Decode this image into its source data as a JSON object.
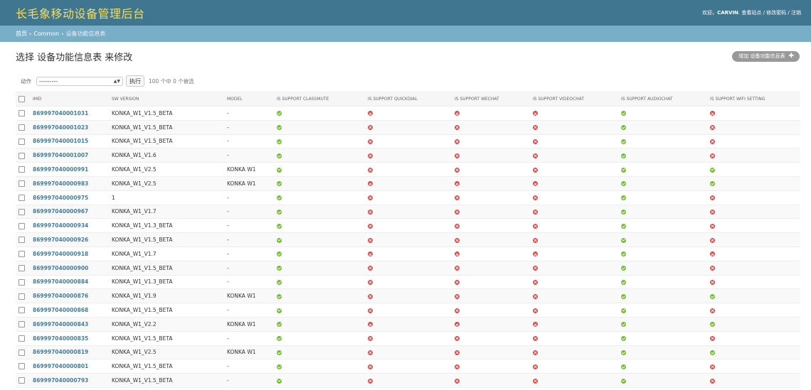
{
  "header": {
    "site_name": "长毛象移动设备管理后台",
    "welcome": "欢迎，",
    "username": "CARVIN",
    "view_site": "查看站点",
    "change_password": "修改密码",
    "logout": "注销",
    "separator": "/"
  },
  "breadcrumbs": {
    "home": "首页",
    "app": "Common",
    "current": "设备功能信息表",
    "separator": "›"
  },
  "page": {
    "title": "选择 设备功能信息表 来修改",
    "add_label": "增加 设备功能信息表",
    "add_icon": "plus-icon"
  },
  "actions": {
    "label": "动作",
    "selected_option": "---------",
    "go_label": "执行",
    "counter": "100 个中 0 个被选"
  },
  "colors": {
    "header_bg": "#417690",
    "brand": "#f5dd5d",
    "breadcrumb_bg": "#79aec8",
    "link": "#447e9b",
    "yes": "#70bf2b",
    "no": "#dd4646"
  },
  "table": {
    "columns": [
      "IMEI",
      "SW VERSION",
      "MODEL",
      "IS SUPPORT CLASSMUTE",
      "IS SUPPORT QUICKDIAL",
      "IS SUPPORT WECHAT",
      "IS SUPPORT VIDEOCHAT",
      "IS SUPPORT AUDIOCHAT",
      "IS SUPPORT WIFI SETTING"
    ],
    "rows": [
      {
        "imei": "869997040001031",
        "sw": "KONKA_W1_V1.5_BETA",
        "model": "-",
        "flags": [
          true,
          false,
          false,
          false,
          true,
          false
        ]
      },
      {
        "imei": "869997040001023",
        "sw": "KONKA_W1_V1.5_BETA",
        "model": "-",
        "flags": [
          true,
          false,
          false,
          false,
          true,
          false
        ]
      },
      {
        "imei": "869997040001015",
        "sw": "KONKA_W1_V1.5_BETA",
        "model": "-",
        "flags": [
          true,
          false,
          false,
          false,
          true,
          false
        ]
      },
      {
        "imei": "869997040001007",
        "sw": "KONKA_W1_V1.6",
        "model": "-",
        "flags": [
          true,
          false,
          false,
          false,
          true,
          false
        ]
      },
      {
        "imei": "869997040000991",
        "sw": "KONKA_W1_V2.5",
        "model": "KONKA W1",
        "flags": [
          true,
          false,
          false,
          false,
          true,
          true
        ]
      },
      {
        "imei": "869997040000983",
        "sw": "KONKA_W1_V2.5",
        "model": "KONKA W1",
        "flags": [
          true,
          false,
          false,
          false,
          true,
          true
        ]
      },
      {
        "imei": "869997040000975",
        "sw": "1",
        "model": "-",
        "flags": [
          true,
          false,
          false,
          false,
          true,
          false
        ]
      },
      {
        "imei": "869997040000967",
        "sw": "KONKA_W1_V1.7",
        "model": "-",
        "flags": [
          true,
          false,
          false,
          false,
          true,
          false
        ]
      },
      {
        "imei": "869997040000934",
        "sw": "KONKA_W1_V1.3_BETA",
        "model": "-",
        "flags": [
          true,
          false,
          false,
          false,
          true,
          false
        ]
      },
      {
        "imei": "869997040000926",
        "sw": "KONKA_W1_V1.5_BETA",
        "model": "-",
        "flags": [
          true,
          false,
          false,
          false,
          true,
          false
        ]
      },
      {
        "imei": "869997040000918",
        "sw": "KONKA_W1_V1.7",
        "model": "-",
        "flags": [
          true,
          false,
          false,
          false,
          true,
          false
        ]
      },
      {
        "imei": "869997040000900",
        "sw": "KONKA_W1_V1.5_BETA",
        "model": "-",
        "flags": [
          true,
          false,
          false,
          false,
          true,
          false
        ]
      },
      {
        "imei": "869997040000884",
        "sw": "KONKA_W1_V1.3_BETA",
        "model": "-",
        "flags": [
          true,
          false,
          false,
          false,
          true,
          false
        ]
      },
      {
        "imei": "869997040000876",
        "sw": "KONKA_W1_V1.9",
        "model": "KONKA W1",
        "flags": [
          true,
          false,
          false,
          false,
          true,
          true
        ]
      },
      {
        "imei": "869997040000868",
        "sw": "KONKA_W1_V1.5_BETA",
        "model": "-",
        "flags": [
          true,
          false,
          false,
          false,
          true,
          false
        ]
      },
      {
        "imei": "869997040000843",
        "sw": "KONKA_W1_V2.2",
        "model": "KONKA W1",
        "flags": [
          true,
          false,
          false,
          false,
          true,
          true
        ]
      },
      {
        "imei": "869997040000835",
        "sw": "KONKA_W1_V1.5_BETA",
        "model": "-",
        "flags": [
          true,
          false,
          false,
          false,
          true,
          false
        ]
      },
      {
        "imei": "869997040000819",
        "sw": "KONKA_W1_V2.5",
        "model": "KONKA W1",
        "flags": [
          true,
          false,
          false,
          false,
          true,
          true
        ]
      },
      {
        "imei": "869997040000801",
        "sw": "KONKA_W1_V1.5_BETA",
        "model": "-",
        "flags": [
          true,
          false,
          false,
          false,
          true,
          false
        ]
      },
      {
        "imei": "869997040000793",
        "sw": "KONKA_W1_V1.5_BETA",
        "model": "-",
        "flags": [
          true,
          false,
          false,
          false,
          true,
          false
        ]
      }
    ]
  }
}
